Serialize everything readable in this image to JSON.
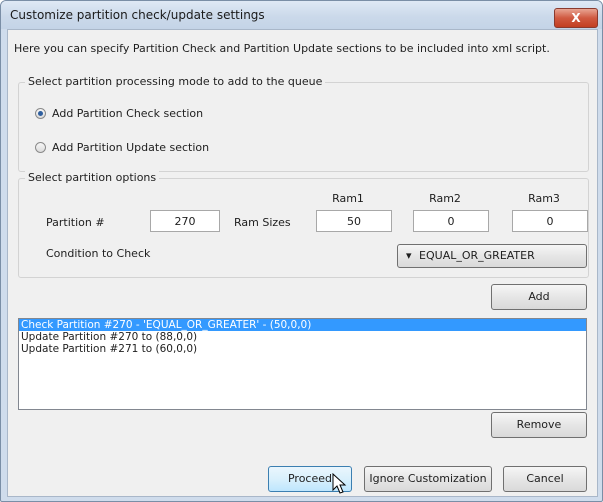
{
  "window": {
    "title": "Customize partition check/update settings",
    "close_glyph": "X",
    "close_icon": "close-icon"
  },
  "intro_text": "Here you can specify Partition Check and Partition Update sections to be included into xml script.",
  "mode_group": {
    "label": "Select partition processing mode to add to the queue",
    "options": [
      {
        "label": "Add Partition Check section",
        "selected": true
      },
      {
        "label": "Add Partition Update section",
        "selected": false
      }
    ]
  },
  "options_group": {
    "label": "Select partition options",
    "partition_label": "Partition #",
    "partition_value": "270",
    "ram_sizes_label": "Ram Sizes",
    "ram_headers": [
      "Ram1",
      "Ram2",
      "Ram3"
    ],
    "ram_values": [
      "50",
      "0",
      "0"
    ],
    "condition_label": "Condition to Check",
    "condition_value": "EQUAL_OR_GREATER",
    "add_label": "Add"
  },
  "queue": {
    "items": [
      "Check Partition #270 - 'EQUAL_OR_GREATER' - (50,0,0)",
      "Update Partition #270 to (88,0,0)",
      "Update Partition #271 to (60,0,0)"
    ],
    "selected_index": 0
  },
  "buttons": {
    "remove": "Remove",
    "proceed": "Proceed",
    "ignore": "Ignore Customization",
    "cancel": "Cancel"
  },
  "colors": {
    "selection": "#3399ff",
    "close_button": "#c94a2f",
    "title_bar": "#cbd9ea"
  }
}
